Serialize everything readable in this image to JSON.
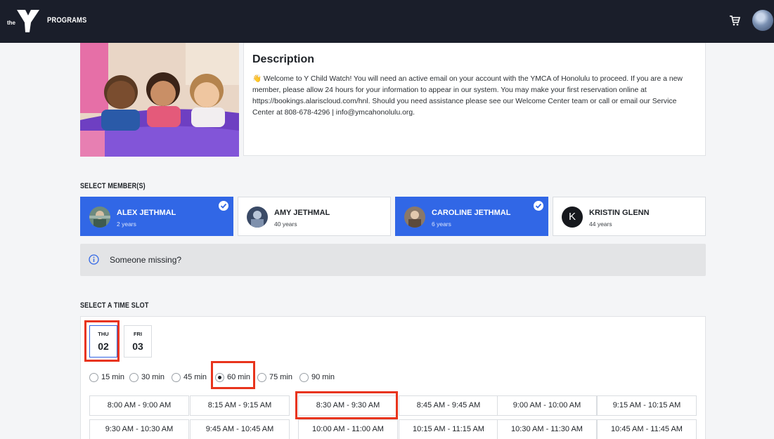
{
  "header": {
    "logo_text": "the",
    "nav_label": "PROGRAMS",
    "cart_icon": "cart-icon",
    "avatar_icon": "user-avatar"
  },
  "description": {
    "title": "Description",
    "emoji": "👋",
    "text": "Welcome to Y Child Watch! You will need an active email on your account with the YMCA of Honolulu to proceed. If you are a new member, please allow 24 hours for your information to appear in our system. You may make your first reservation online at https://bookings.alariscloud.com/hnl. Should you need assistance please see our Welcome Center team or call or email our Service Center at 808-678-4296 | info@ymcahonolulu.org."
  },
  "members_section": {
    "label": "SELECT MEMBER(S)",
    "members": [
      {
        "name": "ALEX JETHMAL",
        "age": "2 years",
        "selected": true
      },
      {
        "name": "AMY JETHMAL",
        "age": "40 years",
        "selected": false
      },
      {
        "name": "CAROLINE JETHMAL",
        "age": "6 years",
        "selected": true
      },
      {
        "name": "KRISTIN GLENN",
        "age": "44 years",
        "selected": false,
        "initial": "K"
      }
    ]
  },
  "missing": {
    "text": "Someone missing?"
  },
  "timeslot_section": {
    "label": "SELECT A TIME SLOT",
    "days": [
      {
        "dow": "THU",
        "num": "02",
        "selected": true
      },
      {
        "dow": "FRI",
        "num": "03",
        "selected": false
      }
    ],
    "durations": [
      {
        "label": "15 min",
        "selected": false
      },
      {
        "label": "30 min",
        "selected": false
      },
      {
        "label": "45 min",
        "selected": false
      },
      {
        "label": "60 min",
        "selected": true
      },
      {
        "label": "75 min",
        "selected": false
      },
      {
        "label": "90 min",
        "selected": false
      }
    ],
    "slots": [
      "8:00 AM - 9:00 AM",
      "8:15 AM - 9:15 AM",
      "8:30 AM - 9:30 AM",
      "8:45 AM - 9:45 AM",
      "9:00 AM - 10:00 AM",
      "9:15 AM - 10:15 AM",
      "9:30 AM - 10:30 AM",
      "9:45 AM - 10:45 AM",
      "10:00 AM - 11:00 AM",
      "10:15 AM - 11:15 AM",
      "10:30 AM - 11:30 AM",
      "10:45 AM - 11:45 AM"
    ]
  },
  "colors": {
    "header_bg": "#1a1e2a",
    "accent": "#3167e6",
    "highlight": "#e8341c"
  }
}
